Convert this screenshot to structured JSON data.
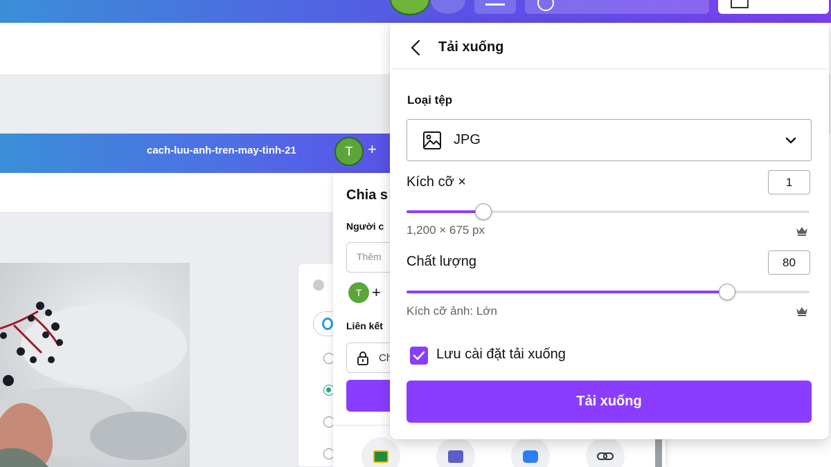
{
  "colors": {
    "accent": "#8b3dff",
    "header_gradient_start": "#3a8fd8",
    "header_gradient_end": "#7b3ff0",
    "avatar_green": "#5aa63a"
  },
  "background": {
    "design_title": "cach-luu-anh-tren-may-tinh-21",
    "avatar_initial": "T",
    "add_symbol": "+"
  },
  "share_panel": {
    "title": "Chia s",
    "people_label": "Người c",
    "input_placeholder": "Thêm",
    "avatar_initial": "T",
    "add_symbol": "+",
    "link_label": "Liên kết",
    "link_value": "Ch",
    "apps": [
      "google-classroom-icon",
      "microsoft-teams-icon",
      "chat-icon",
      "link-icon"
    ]
  },
  "download_panel": {
    "title": "Tải xuống",
    "file_type_label": "Loại tệp",
    "file_type": {
      "value": "JPG",
      "icon": "image-icon"
    },
    "size": {
      "label": "Kích cỡ ×",
      "value": "1",
      "slider_fraction": 0.19,
      "dimensions": "1,200 × 675 px",
      "pro_icon": "crown-icon"
    },
    "quality": {
      "label": "Chất lượng",
      "value": "80",
      "slider_fraction": 0.795,
      "size_text": "Kích cỡ ảnh: Lớn",
      "pro_icon": "crown-icon"
    },
    "save_settings": {
      "label": "Lưu cài đặt tải xuống",
      "checked": true
    },
    "download_button": "Tải xuống"
  }
}
